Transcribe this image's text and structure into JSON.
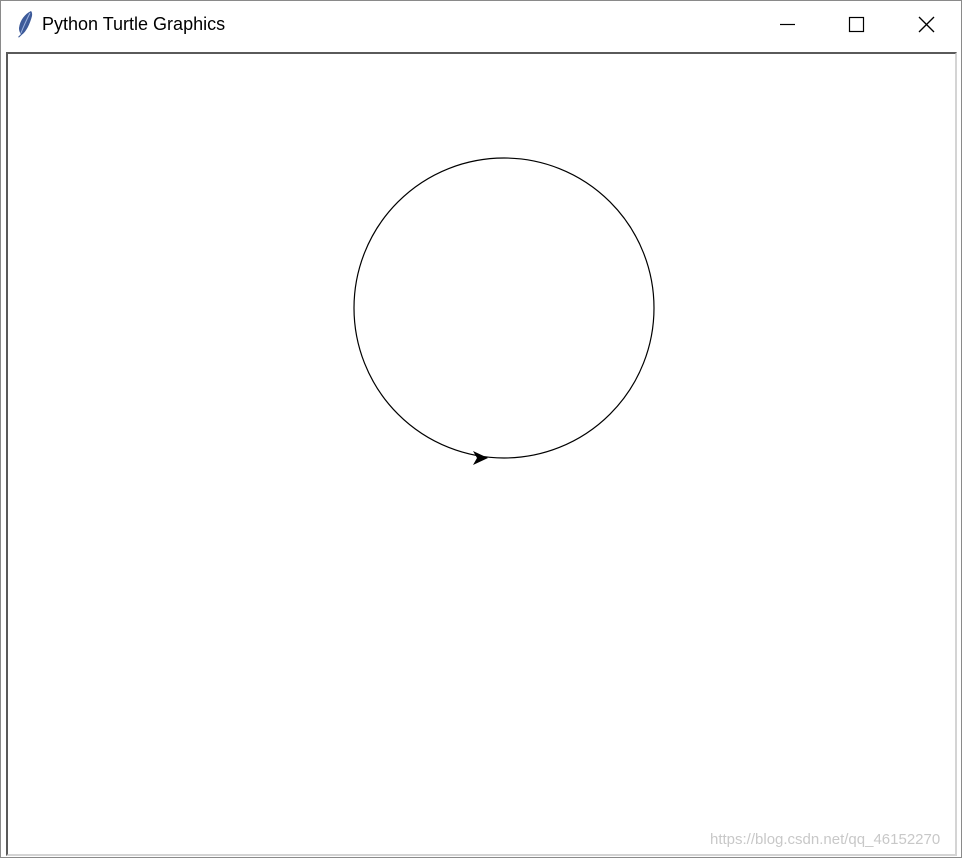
{
  "window": {
    "title": "Python Turtle Graphics",
    "icons": {
      "app": "feather-icon",
      "minimize": "minimize-icon",
      "maximize": "maximize-icon",
      "close": "close-icon"
    }
  },
  "canvas": {
    "background": "#ffffff",
    "pen_color": "#000000",
    "drawing": "circle",
    "turtle_shape": "arrow",
    "turtle_heading": "right"
  },
  "watermark": {
    "text": "https://blog.csdn.net/qq_46152270"
  }
}
